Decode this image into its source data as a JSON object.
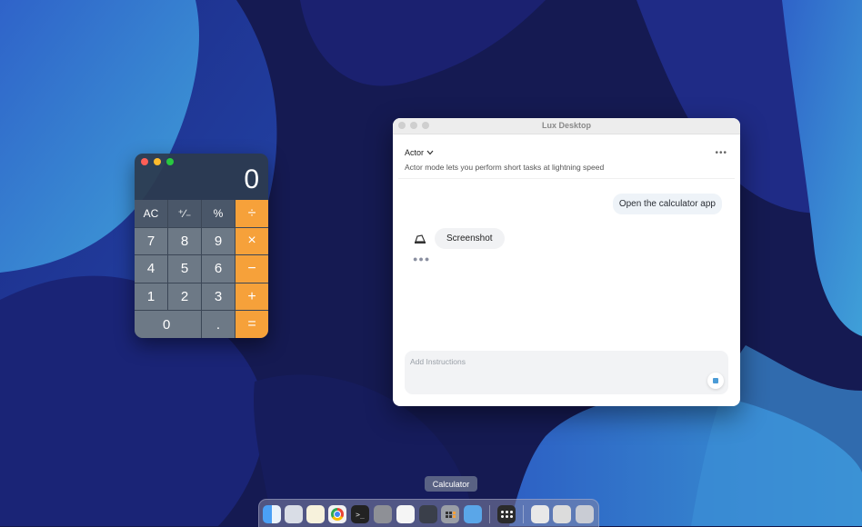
{
  "calculator": {
    "display": "0",
    "keys": [
      {
        "label": "AC",
        "type": "fn",
        "name": "calc-key-ac"
      },
      {
        "label": "⁺∕₋",
        "type": "fn",
        "name": "calc-key-plus-minus"
      },
      {
        "label": "%",
        "type": "fn",
        "name": "calc-key-percent"
      },
      {
        "label": "÷",
        "type": "op",
        "name": "calc-key-divide"
      },
      {
        "label": "7",
        "type": "num",
        "name": "calc-key-7"
      },
      {
        "label": "8",
        "type": "num",
        "name": "calc-key-8"
      },
      {
        "label": "9",
        "type": "num",
        "name": "calc-key-9"
      },
      {
        "label": "×",
        "type": "op",
        "name": "calc-key-multiply"
      },
      {
        "label": "4",
        "type": "num",
        "name": "calc-key-4"
      },
      {
        "label": "5",
        "type": "num",
        "name": "calc-key-5"
      },
      {
        "label": "6",
        "type": "num",
        "name": "calc-key-6"
      },
      {
        "label": "−",
        "type": "op",
        "name": "calc-key-minus"
      },
      {
        "label": "1",
        "type": "num",
        "name": "calc-key-1"
      },
      {
        "label": "2",
        "type": "num",
        "name": "calc-key-2"
      },
      {
        "label": "3",
        "type": "num",
        "name": "calc-key-3"
      },
      {
        "label": "+",
        "type": "op",
        "name": "calc-key-plus"
      },
      {
        "label": "0",
        "type": "num zero",
        "name": "calc-key-0"
      },
      {
        "label": ".",
        "type": "num",
        "name": "calc-key-decimal"
      },
      {
        "label": "=",
        "type": "op",
        "name": "calc-key-equals"
      }
    ]
  },
  "lux": {
    "title": "Lux Desktop",
    "mode_label": "Actor",
    "mode_description": "Actor mode lets you perform short tasks at lightning speed",
    "user_message": "Open the calculator app",
    "agent_message": "Screenshot",
    "input_placeholder": "Add Instructions"
  },
  "dock": {
    "tooltip": "Calculator",
    "icons": [
      {
        "name": "finder-icon",
        "bg": "#3b8ff0"
      },
      {
        "name": "launchpad-icon",
        "bg": "#d9dde6"
      },
      {
        "name": "notes-icon",
        "bg": "#f7f2dc"
      },
      {
        "name": "chrome-icon",
        "bg": "#f2f2f2"
      },
      {
        "name": "terminal-icon",
        "bg": "#222222"
      },
      {
        "name": "system-settings-icon",
        "bg": "#8e9096"
      },
      {
        "name": "textedit-icon",
        "bg": "#f5f5f5"
      },
      {
        "name": "quicktime-icon",
        "bg": "#3a3f4a"
      },
      {
        "name": "calculator-icon",
        "bg": "#9a9ea6"
      },
      {
        "name": "preview-icon",
        "bg": "#5aa6e8"
      },
      {
        "name": "app-grid-icon",
        "bg": "#2b2b2b"
      },
      {
        "name": "window-thumbnail-1-icon",
        "bg": "#e8e8e8"
      },
      {
        "name": "window-thumbnail-2-icon",
        "bg": "#dcdcdc"
      },
      {
        "name": "trash-icon",
        "bg": "#c9ccd4"
      }
    ]
  }
}
